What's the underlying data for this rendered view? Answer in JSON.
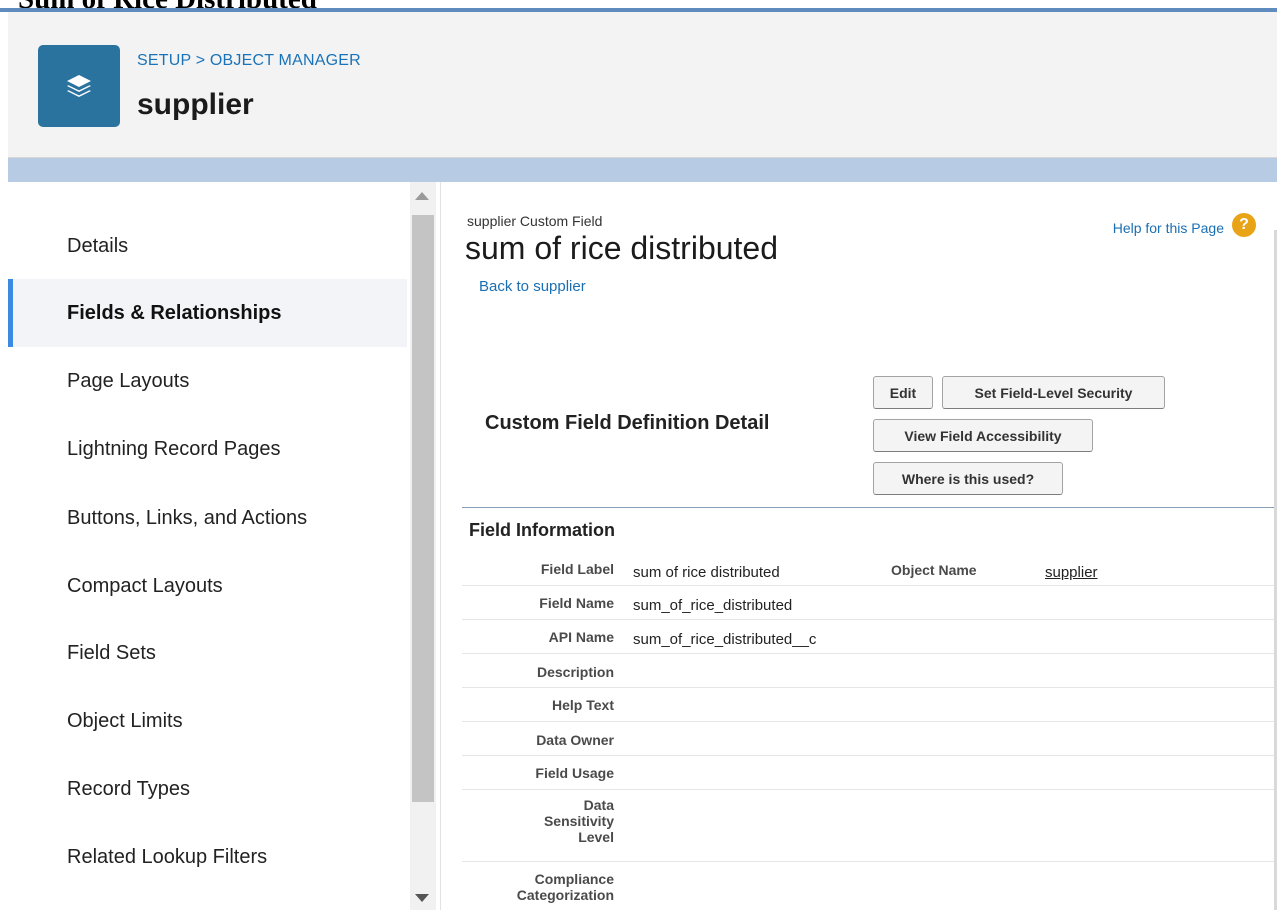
{
  "document_title": "Sum of Rice Distributed",
  "header": {
    "breadcrumb": "SETUP > OBJECT MANAGER",
    "object_name": "supplier",
    "icon": "stacked-layers-icon"
  },
  "sidebar": {
    "items": [
      {
        "label": "Details",
        "active": false
      },
      {
        "label": "Fields & Relationships",
        "active": true
      },
      {
        "label": "Page Layouts",
        "active": false
      },
      {
        "label": "Lightning Record Pages",
        "active": false
      },
      {
        "label": "Buttons, Links, and Actions",
        "active": false
      },
      {
        "label": "Compact Layouts",
        "active": false
      },
      {
        "label": "Field Sets",
        "active": false
      },
      {
        "label": "Object Limits",
        "active": false
      },
      {
        "label": "Record Types",
        "active": false
      },
      {
        "label": "Related Lookup Filters",
        "active": false
      }
    ]
  },
  "content": {
    "eyebrow": "supplier Custom Field",
    "title": "sum of rice distributed",
    "back_link": "Back to supplier",
    "help_link": "Help for this Page",
    "help_icon": "?",
    "definition_heading": "Custom Field Definition Detail",
    "buttons": {
      "edit": "Edit",
      "set_security": "Set Field-Level Security",
      "view_accessibility": "View Field Accessibility",
      "where_used": "Where is this used?"
    },
    "field_info_heading": "Field Information",
    "field_rows": [
      {
        "label": "Field Label",
        "value": "sum of rice distributed",
        "label2": "Object Name",
        "value2": "supplier"
      },
      {
        "label": "Field Name",
        "value": "sum_of_rice_distributed"
      },
      {
        "label": "API Name",
        "value": "sum_of_rice_distributed__c"
      },
      {
        "label": "Description",
        "value": ""
      },
      {
        "label": "Help Text",
        "value": ""
      },
      {
        "label": "Data Owner",
        "value": ""
      },
      {
        "label": "Field Usage",
        "value": ""
      },
      {
        "label": "Data Sensitivity Level",
        "value": ""
      },
      {
        "label": "Compliance Categorization",
        "value": ""
      }
    ]
  },
  "colors": {
    "accent_blue": "#1a73b9",
    "icon_tile": "#2a739e",
    "active_bar": "#3a8ae0",
    "help_orange": "#e9a317"
  }
}
